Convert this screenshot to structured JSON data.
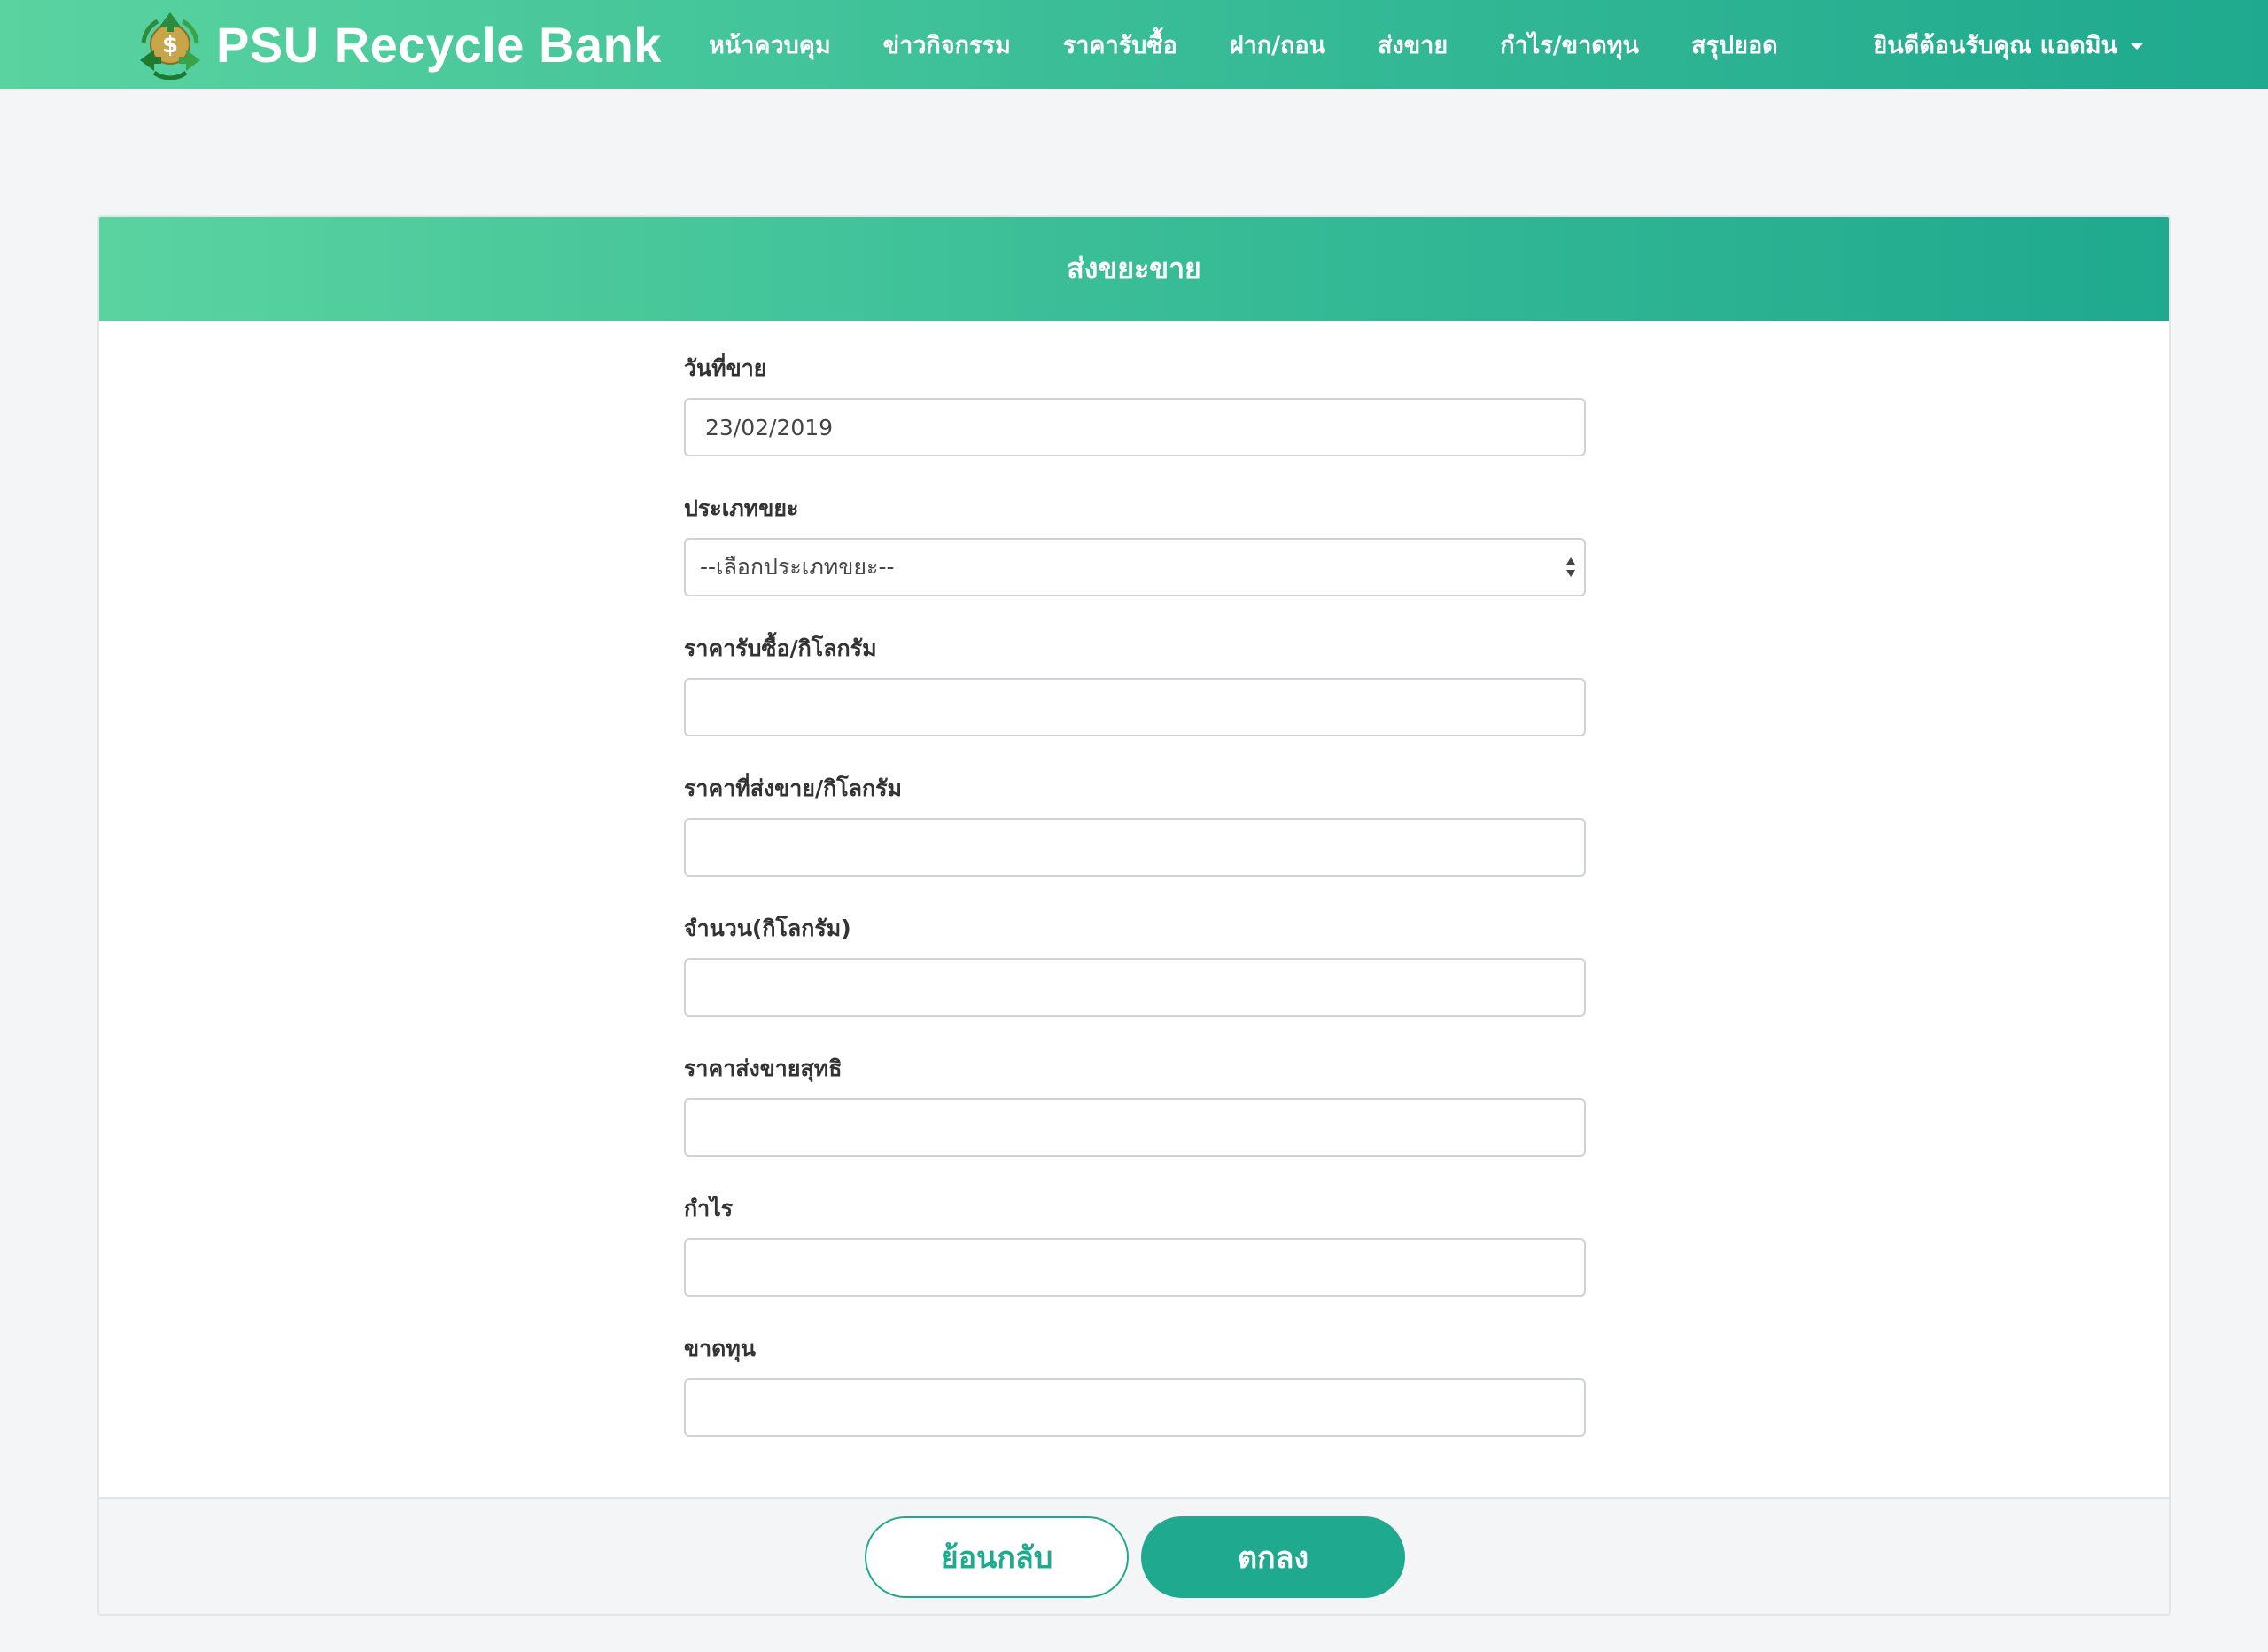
{
  "brand": {
    "name": "PSU Recycle Bank"
  },
  "nav": {
    "links": [
      "หน้าควบคุม",
      "ข่าวกิจกรรม",
      "ราคารับซื้อ",
      "ฝาก/ถอน",
      "ส่งขาย",
      "กำไร/ขาดทุน",
      "สรุปยอด"
    ],
    "user_greeting": "ยินดีต้อนรับคุณ แอดมิน"
  },
  "form": {
    "title": "ส่งขยะขาย",
    "sale_date": {
      "label": "วันที่ขาย",
      "value": "23/02/2019"
    },
    "waste_type": {
      "label": "ประเภทขยะ",
      "selected": "--เลือกประเภทขยะ--"
    },
    "buy_price": {
      "label": "ราคารับซื้อ/กิโลกรัม",
      "value": ""
    },
    "sell_price": {
      "label": "ราคาที่ส่งขาย/กิโลกรัม",
      "value": ""
    },
    "quantity": {
      "label": "จำนวน(กิโลกรัม)",
      "value": ""
    },
    "net_price": {
      "label": "ราคาส่งขายสุทธิ",
      "value": ""
    },
    "profit": {
      "label": "กำไร",
      "value": ""
    },
    "loss": {
      "label": "ขาดทุน",
      "value": ""
    }
  },
  "buttons": {
    "back": "ย้อนกลับ",
    "ok": "ตกลง"
  },
  "colors": {
    "accent": "#1fa98e",
    "gradient_start": "#5ad3a0",
    "background": "#f4f5f7"
  },
  "icons": {
    "logo": "recycle-money-logo-icon",
    "user_menu": "caret-down-icon",
    "select": "select-arrows-icon"
  }
}
